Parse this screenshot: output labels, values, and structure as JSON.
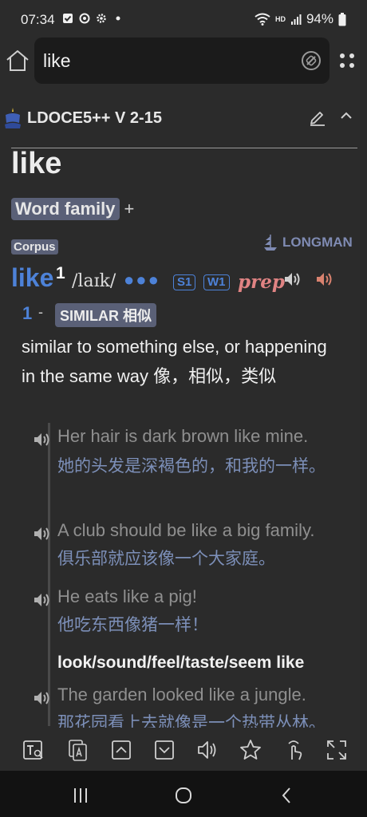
{
  "status_bar": {
    "time": "07:34",
    "battery": "94%",
    "network_label": "HD",
    "icons": [
      "checkbox-notification-icon",
      "sync-icon",
      "settings-gear-icon",
      "dot-icon",
      "wifi-icon",
      "signal-icon",
      "battery-icon"
    ]
  },
  "search": {
    "value": "like",
    "icons": [
      "home-icon",
      "clear-icon",
      "menu-dots-icon"
    ]
  },
  "dictionary": {
    "name": "LDOCE5++ V 2-15",
    "icons": [
      "dictionary-logo-icon",
      "edit-icon",
      "chevron-up-icon"
    ]
  },
  "entry": {
    "headword": "like",
    "word_family_label": "Word family",
    "word_family_toggle": "+",
    "corpus_label": "Corpus",
    "publisher_label": "LONGMAN",
    "word": "like",
    "homograph": "1",
    "pronunciation": "/laɪk/",
    "frequency_dots": "●●●",
    "frequency_tags": [
      "S1",
      "W1"
    ],
    "part_of_speech": "prep",
    "sense": {
      "number": "1",
      "dash": "-",
      "signpost": "SIMILAR 相似",
      "definition": "similar to something else, or happening in the same way 像，相似，类似"
    },
    "examples": [
      {
        "en": "Her hair is dark brown like mine.",
        "zh": "她的头发是深褐色的，和我的一样。"
      },
      {
        "en": "A club should be like a big family.",
        "zh": "俱乐部就应该像一个大家庭。"
      },
      {
        "en": "He eats like a pig!",
        "zh": "他吃东西像猪一样！"
      },
      {
        "en": "The garden looked like a jungle.",
        "zh": "那花园看上去就像是一个热带丛林。"
      }
    ],
    "collocation": "look/sound/feel/taste/seem like"
  },
  "colors": {
    "background": "#2b2b2b",
    "accent_blue": "#4d82d8",
    "signpost_bg": "#5a6077",
    "pos_color": "#e08383",
    "speaker_red": "#d9826f",
    "example_text": "#8f8f8f",
    "translation_text": "#7c8fb8"
  },
  "toolbar": {
    "buttons": [
      "text-search-icon",
      "translate-icon",
      "previous-entry-icon",
      "next-entry-icon",
      "speaker-icon",
      "favorite-star-icon",
      "tap-gesture-icon",
      "fullscreen-icon"
    ]
  },
  "nav": {
    "buttons": [
      "recent-apps-icon",
      "home-circle-icon",
      "back-icon"
    ]
  }
}
